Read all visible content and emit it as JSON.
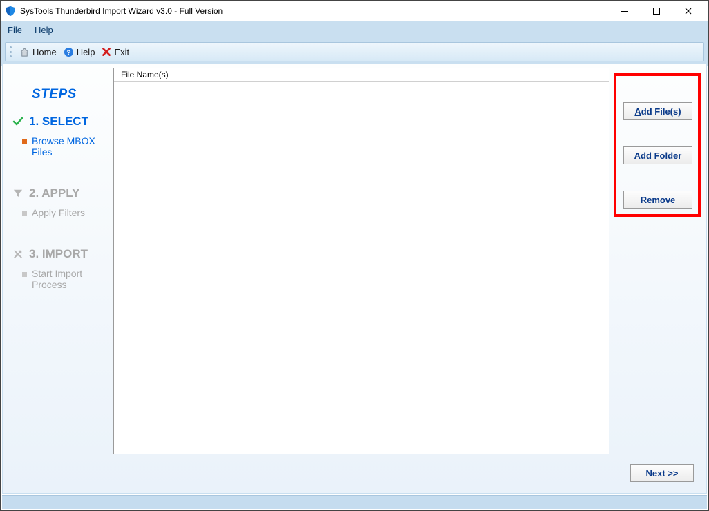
{
  "window": {
    "title": "SysTools Thunderbird Import Wizard v3.0 - Full Version"
  },
  "menu": {
    "file": "File",
    "help": "Help"
  },
  "toolbar": {
    "home": "Home",
    "help": "Help",
    "exit": "Exit"
  },
  "sidebar": {
    "heading": "STEPS",
    "step1": {
      "title": "1. SELECT",
      "sub": "Browse MBOX Files"
    },
    "step2": {
      "title": "2. APPLY",
      "sub": "Apply Filters"
    },
    "step3": {
      "title": "3. IMPORT",
      "sub": "Start Import Process"
    }
  },
  "filelist": {
    "column": "File Name(s)"
  },
  "actions": {
    "add_files_pre": "A",
    "add_files_mid": "dd File(s)",
    "add_folder_pre": "Add ",
    "add_folder_key": "F",
    "add_folder_post": "older",
    "remove_key": "R",
    "remove_post": "emove",
    "next_key": "N",
    "next_post": "ext >>"
  }
}
